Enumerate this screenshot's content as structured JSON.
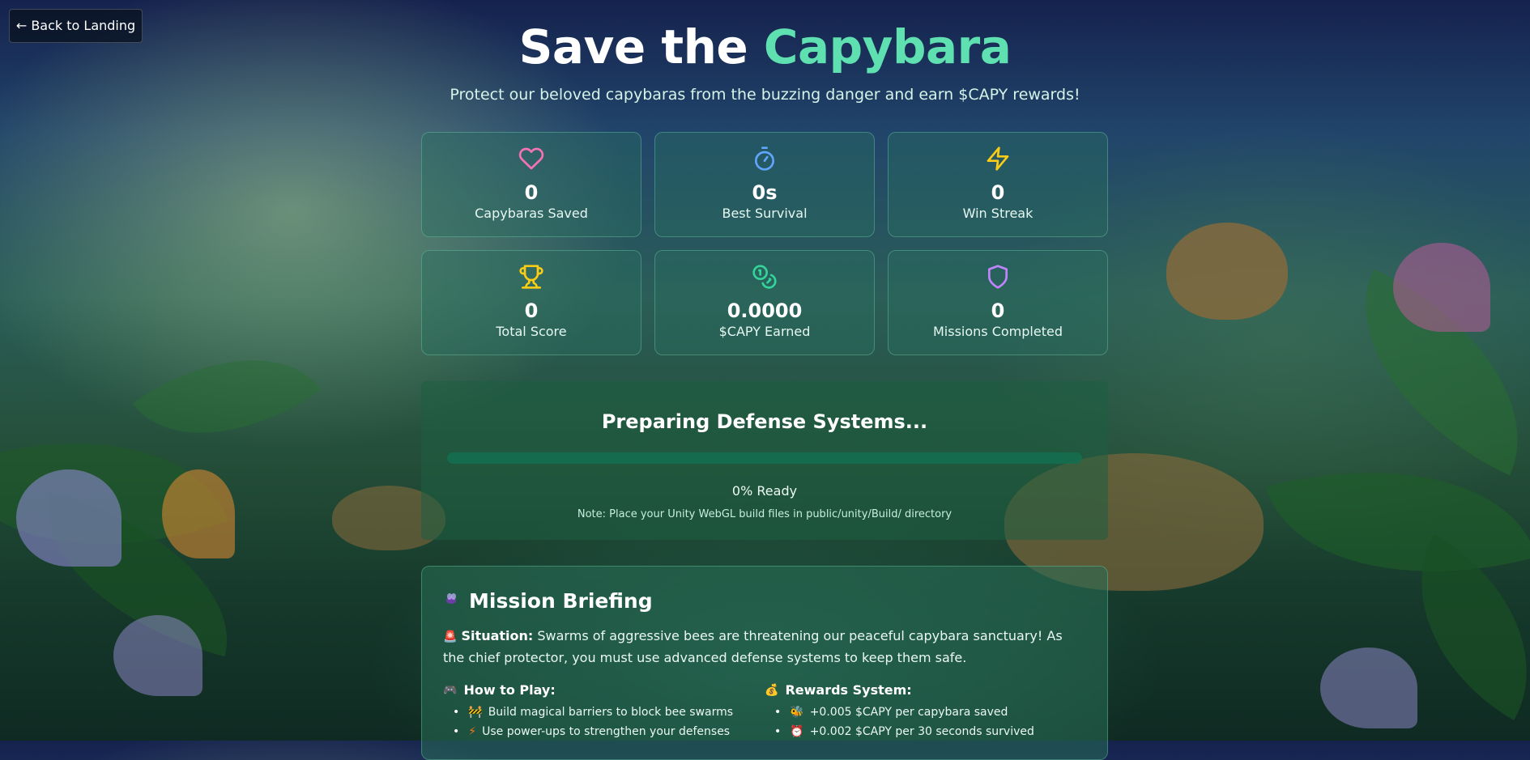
{
  "nav": {
    "back_label": "← Back to Landing"
  },
  "header": {
    "title_prefix": "Save the ",
    "title_accent": "Capybara",
    "subtitle": "Protect our beloved capybaras from the buzzing danger and earn $CAPY rewards!"
  },
  "stats": [
    {
      "icon": "heart-icon",
      "value": "0",
      "label": "Capybaras Saved",
      "color": "#f472b6"
    },
    {
      "icon": "stopwatch-icon",
      "value": "0s",
      "label": "Best Survival",
      "color": "#60a5fa"
    },
    {
      "icon": "lightning-icon",
      "value": "0",
      "label": "Win Streak",
      "color": "#facc15"
    },
    {
      "icon": "trophy-icon",
      "value": "0",
      "label": "Total Score",
      "color": "#facc15"
    },
    {
      "icon": "coins-icon",
      "value": "0.0000",
      "label": "$CAPY Earned",
      "color": "#34d399"
    },
    {
      "icon": "shield-icon",
      "value": "0",
      "label": "Missions Completed",
      "color": "#c084fc"
    }
  ],
  "loader": {
    "title": "Preparing Defense Systems...",
    "progress": 0,
    "status": "0% Ready",
    "note": "Note: Place your Unity WebGL build files in public/unity/Build/ directory"
  },
  "briefing": {
    "icon": "bee-icon",
    "title": "Mission Briefing",
    "situation_icon": "alarm-icon",
    "situation_label": "Situation:",
    "situation_text": " Swarms of aggressive bees are threatening our peaceful capybara sanctuary! As the chief protector, you must use advanced defense systems to keep them safe.",
    "how_to_play": {
      "icon": "gamepad-icon",
      "title": "How to Play:",
      "items": [
        {
          "icon": "barrier-icon",
          "text": "Build magical barriers to block bee swarms"
        },
        {
          "icon": "bolt-icon",
          "text": "Use power-ups to strengthen your defenses"
        }
      ]
    },
    "rewards": {
      "icon": "money-bag-icon",
      "title": "Rewards System:",
      "items": [
        {
          "icon": "bee-icon",
          "text": "+0.005 $CAPY per capybara saved"
        },
        {
          "icon": "alarm-clock-icon",
          "text": "+0.002 $CAPY per 30 seconds survived"
        }
      ]
    }
  }
}
